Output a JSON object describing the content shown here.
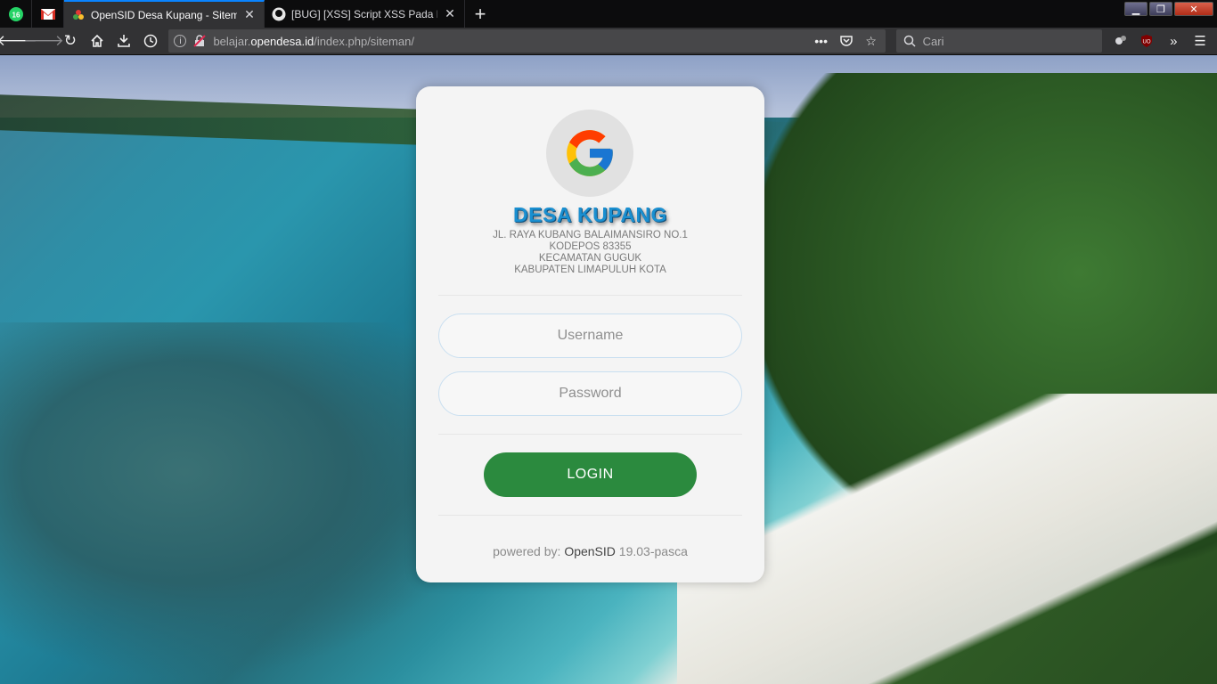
{
  "browser": {
    "pinned_tabs": [
      {
        "name": "whatsapp",
        "badge": "16"
      },
      {
        "name": "gmail"
      }
    ],
    "tabs": [
      {
        "title": "OpenSID Desa Kupang - Siteman",
        "active": true
      },
      {
        "title": "[BUG] [XSS] Script XSS Pada Form",
        "active": false
      }
    ],
    "url": {
      "prefix": "belajar.",
      "host": "opendesa.id",
      "path": "/index.php/siteman/"
    },
    "search_placeholder": "Cari",
    "ublock_badge": "UO"
  },
  "login": {
    "title": "DESA KUPANG",
    "address_lines": [
      "JL. RAYA KUBANG BALAIMANSIRO NO.1",
      "KODEPOS 83355",
      "KECAMATAN GUGUK",
      "KABUPATEN LIMAPULUH KOTA"
    ],
    "username_placeholder": "Username",
    "password_placeholder": "Password",
    "login_label": "LOGIN",
    "powered_prefix": "powered by: ",
    "powered_brand": "OpenSID",
    "powered_version": " 19.03-pasca"
  },
  "colors": {
    "title_blue": "#1a8fd0",
    "login_green": "#2b8a3e",
    "browser_accent": "#0a84ff"
  }
}
